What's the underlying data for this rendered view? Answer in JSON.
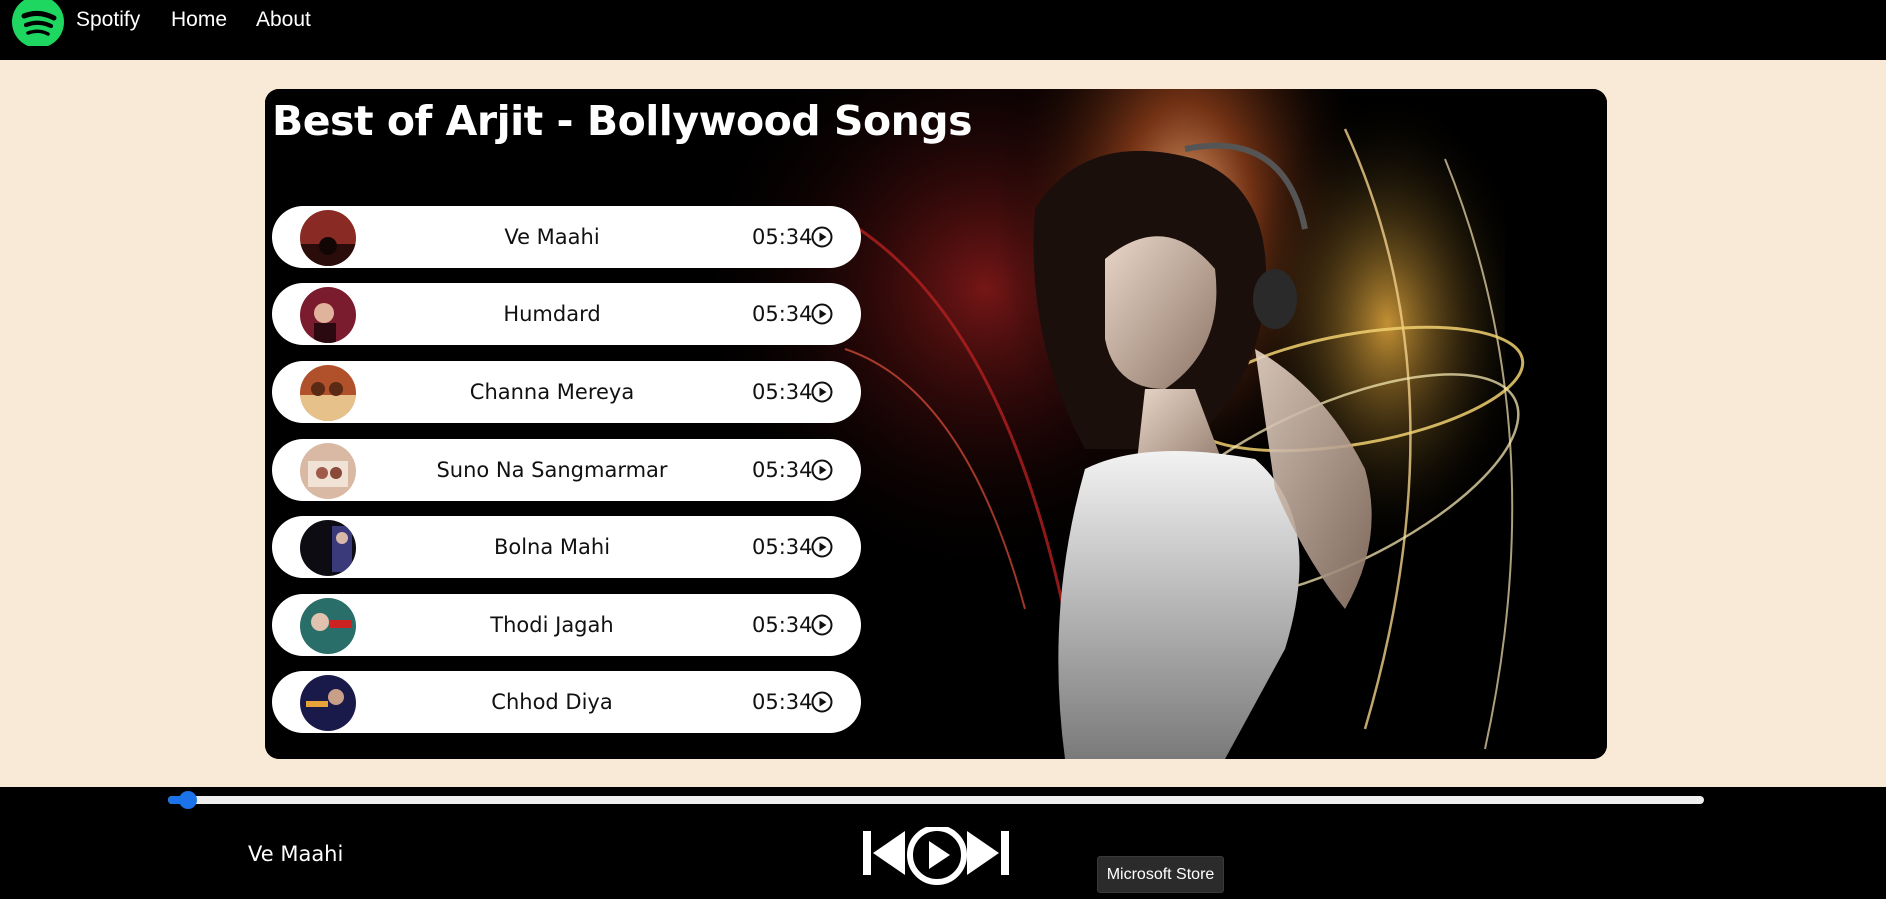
{
  "nav": {
    "brand": "Spotify",
    "links": [
      "Home",
      "About"
    ],
    "logo_icon": "spotify-logo-icon",
    "logo_color": "#1ed760"
  },
  "playlist": {
    "title": "Best of Arjit - Bollywood Songs",
    "songs": [
      {
        "name": "Ve Maahi",
        "duration": "05:34",
        "thumb_color": "#8a2a24"
      },
      {
        "name": "Humdard",
        "duration": "05:34",
        "thumb_color": "#7a1c2e"
      },
      {
        "name": "Channa Mereya",
        "duration": "05:34",
        "thumb_color": "#b0512b"
      },
      {
        "name": "Suno Na Sangmarmar",
        "duration": "05:34",
        "thumb_color": "#d9b8a4"
      },
      {
        "name": "Bolna Mahi",
        "duration": "05:34",
        "thumb_color": "#1c1c2a"
      },
      {
        "name": "Thodi Jagah",
        "duration": "05:34",
        "thumb_color": "#2a6e6a"
      },
      {
        "name": "Chhod Diya",
        "duration": "05:34",
        "thumb_color": "#2a2a6a"
      }
    ],
    "play_icon": "play-circle-icon"
  },
  "player": {
    "now_playing": "Ve Maahi",
    "progress": 0.013,
    "progress_color": "#1a73e8",
    "icons": [
      "previous-icon",
      "play-icon",
      "next-icon"
    ]
  },
  "tooltip": {
    "text": "Microsoft Store"
  }
}
